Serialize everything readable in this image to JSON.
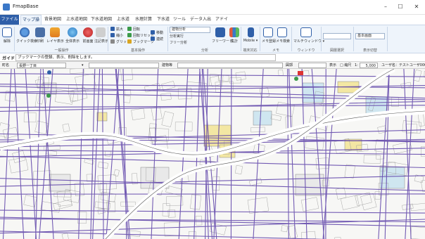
{
  "app": {
    "title": "FmapBase"
  },
  "window_controls": {
    "minimize": "–",
    "maximize": "☐",
    "close": "✕"
  },
  "tabs": {
    "file": "ファイル ▾",
    "items": [
      "マップ操作",
      "背景地図",
      "上水道地図",
      "下水道地図",
      "上水道",
      "水理計算",
      "下水道",
      "ツール",
      "データ入出力",
      "アドイン"
    ]
  },
  "ribbon": {
    "groups": {
      "general": "一般操作",
      "basic": "基本操作",
      "analysis": "分析",
      "terminal": "端末対応",
      "memo": "メモ",
      "window": "ウィンドウ",
      "layer_select": "図層選択",
      "display_switch": "表示切替"
    },
    "buttons": {
      "release": "解除",
      "quick_search": "クイック検索",
      "print": "印刷",
      "layer_display": "レイヤ表示",
      "full_view": "全体表示",
      "prev_screen": "前画面",
      "label_display": "注記表示",
      "free_word": "フリーワード",
      "total": "集計",
      "mobile": "Mobile ▾",
      "memo_register": "メモ登録",
      "memo_search": "メモ検索",
      "multi_window": "マルチウィンドウ ▾"
    },
    "small_buttons": {
      "zoom_in": "拡大",
      "zoom_out": "縮小",
      "grid": "グリッド",
      "rotate": "回転",
      "rotate_reset": "回転リセット",
      "bookmark": "ブックマーク",
      "move": "移動",
      "scroll": "連続",
      "analysis_run": "分析実行",
      "free_analysis": "フリー分析"
    },
    "combos": {
      "analysis_target": "建物分析",
      "layer_select": "",
      "display_mode": "基本画面"
    }
  },
  "guide": {
    "label": "ガイド",
    "text": "ブックマークの登録、表示、削除をします。"
  },
  "status": {
    "town_label": "町名",
    "town_value": "長野一丁目",
    "building_label": "建物等",
    "layer_label": "図郭",
    "display_label": "表示",
    "fixed_label": "□ 縮尺",
    "scale_prefix": "1:",
    "scale_value": "5,000",
    "user": "ユーザ名：テストユーザ0001"
  }
}
